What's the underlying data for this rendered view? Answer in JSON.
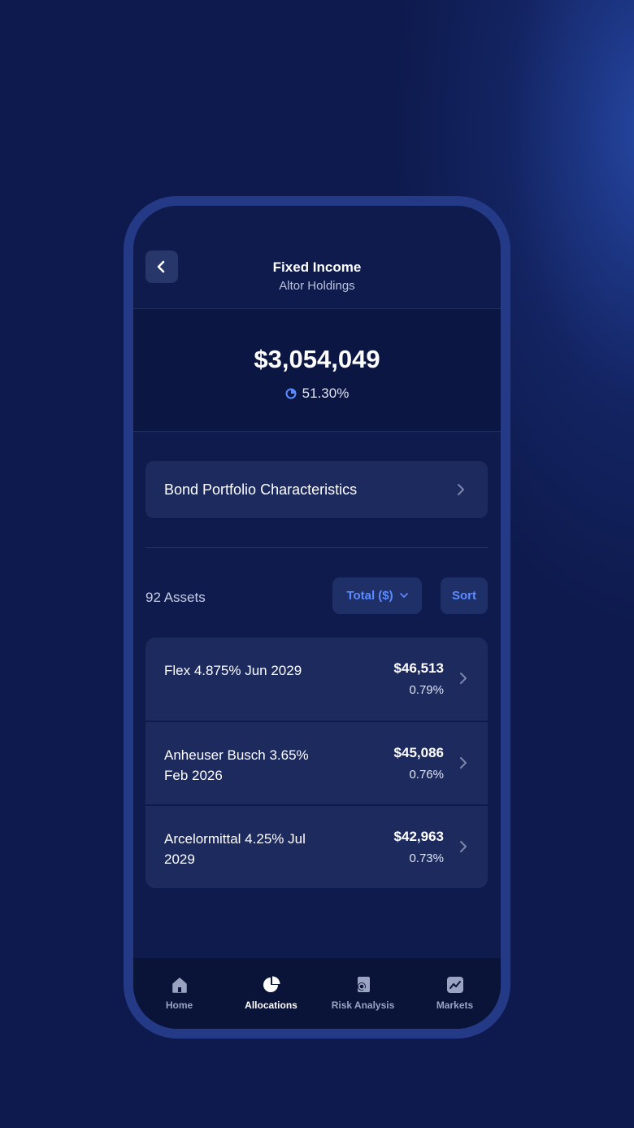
{
  "header": {
    "title": "Fixed Income",
    "subtitle": "Altor Holdings",
    "back_icon": "chevron-left-icon"
  },
  "summary": {
    "total_value": "$3,054,049",
    "allocation_percent": "51.30%",
    "allocation_icon": "pie-chart-icon"
  },
  "characteristics": {
    "label": "Bond Portfolio Characteristics",
    "icon": "chevron-right-icon"
  },
  "assets_toolbar": {
    "count_label": "92 Assets",
    "total_dropdown_label": "Total ($)",
    "sort_label": "Sort"
  },
  "assets": [
    {
      "name": "Flex 4.875% Jun 2029",
      "value": "$46,513",
      "percent": "0.79%"
    },
    {
      "name": "Anheuser Busch 3.65% Feb 2026",
      "value": "$45,086",
      "percent": "0.76%"
    },
    {
      "name": "Arcelormittal 4.25% Jul 2029",
      "value": "$42,963",
      "percent": "0.73%"
    }
  ],
  "tabbar": {
    "items": [
      {
        "label": "Home",
        "icon": "home-icon",
        "active": false
      },
      {
        "label": "Allocations",
        "icon": "pie-chart-icon",
        "active": true
      },
      {
        "label": "Risk Analysis",
        "icon": "risk-analysis-icon",
        "active": false
      },
      {
        "label": "Markets",
        "icon": "markets-chart-icon",
        "active": false
      }
    ]
  },
  "colors": {
    "background": "#0e1a4d",
    "card": "#1d2a5e",
    "accent": "#5b8cff",
    "phone_frame": "#243a86"
  }
}
